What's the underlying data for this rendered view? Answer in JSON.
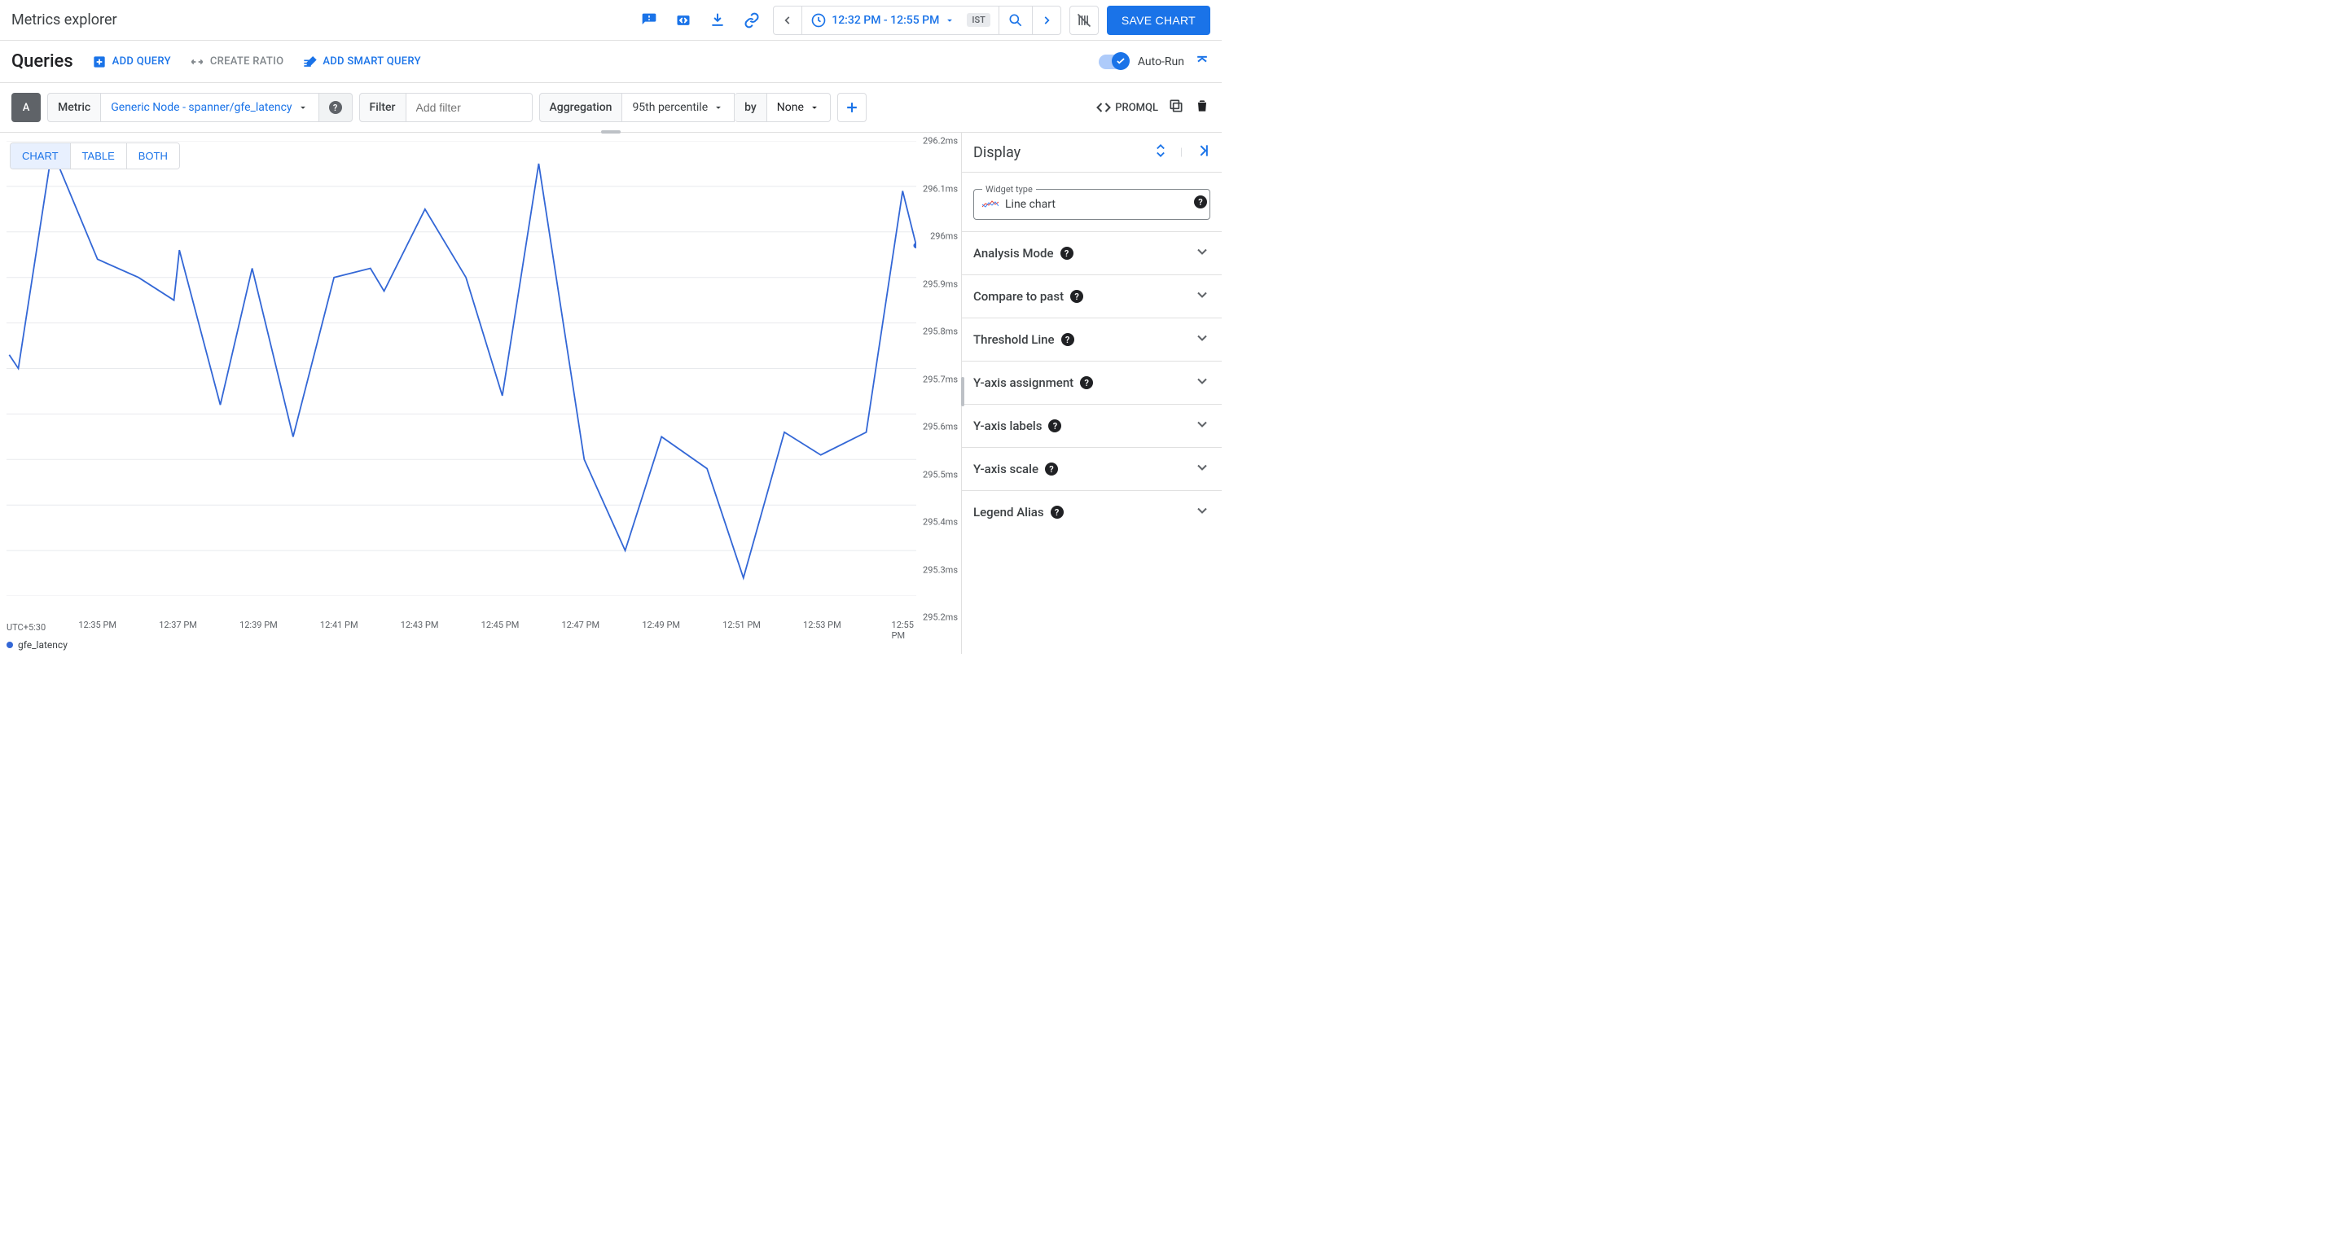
{
  "header": {
    "title": "Metrics explorer",
    "time_label": "12:32 PM - 12:55 PM",
    "tz_chip": "IST",
    "save_label": "SAVE CHART"
  },
  "queries": {
    "title": "Queries",
    "add_query": "ADD QUERY",
    "create_ratio": "CREATE RATIO",
    "add_smart": "ADD SMART QUERY",
    "autorun_label": "Auto-Run",
    "autorun_on": true
  },
  "builder": {
    "badge": "A",
    "metric_label": "Metric",
    "metric_value": "Generic Node - spanner/gfe_latency",
    "filter_label": "Filter",
    "filter_placeholder": "Add filter",
    "agg_label": "Aggregation",
    "agg_value": "95th percentile",
    "by_label": "by",
    "by_value": "None",
    "promql": "PROMQL"
  },
  "view_tabs": [
    "CHART",
    "TABLE",
    "BOTH"
  ],
  "chart_data": {
    "type": "line",
    "xlabel": "",
    "ylabel": "",
    "ylim": [
      295.2,
      296.2
    ],
    "tz": "UTC+5:30",
    "x_ticks": [
      "12:35 PM",
      "12:37 PM",
      "12:39 PM",
      "12:41 PM",
      "12:43 PM",
      "12:45 PM",
      "12:47 PM",
      "12:49 PM",
      "12:51 PM",
      "12:53 PM",
      "12:55 PM"
    ],
    "y_ticks": [
      "296.2ms",
      "296.1ms",
      "296ms",
      "295.9ms",
      "295.8ms",
      "295.7ms",
      "295.6ms",
      "295.5ms",
      "295.4ms",
      "295.3ms",
      "295.2ms"
    ],
    "series": [
      {
        "name": "gfe_latency",
        "points": [
          [
            0.003,
            295.73
          ],
          [
            0.013,
            295.7
          ],
          [
            0.05,
            296.18
          ],
          [
            0.1,
            295.94
          ],
          [
            0.145,
            295.9
          ],
          [
            0.184,
            295.85
          ],
          [
            0.19,
            295.96
          ],
          [
            0.235,
            295.62
          ],
          [
            0.27,
            295.92
          ],
          [
            0.315,
            295.55
          ],
          [
            0.36,
            295.9
          ],
          [
            0.4,
            295.92
          ],
          [
            0.415,
            295.87
          ],
          [
            0.46,
            296.05
          ],
          [
            0.505,
            295.9
          ],
          [
            0.545,
            295.64
          ],
          [
            0.585,
            296.15
          ],
          [
            0.635,
            295.5
          ],
          [
            0.68,
            295.3
          ],
          [
            0.72,
            295.55
          ],
          [
            0.77,
            295.48
          ],
          [
            0.81,
            295.24
          ],
          [
            0.855,
            295.56
          ],
          [
            0.895,
            295.51
          ],
          [
            0.945,
            295.56
          ],
          [
            0.985,
            296.09
          ],
          [
            1.0,
            295.97
          ]
        ],
        "terminal_dot": [
          1.0,
          295.97
        ]
      }
    ]
  },
  "legend_label": "gfe_latency",
  "side": {
    "title": "Display",
    "widget_label": "Widget type",
    "widget_value": "Line chart",
    "rows": [
      {
        "label": "Analysis Mode"
      },
      {
        "label": "Compare to past"
      },
      {
        "label": "Threshold Line"
      },
      {
        "label": "Y-axis assignment"
      },
      {
        "label": "Y-axis labels"
      },
      {
        "label": "Y-axis scale"
      },
      {
        "label": "Legend Alias"
      }
    ]
  }
}
